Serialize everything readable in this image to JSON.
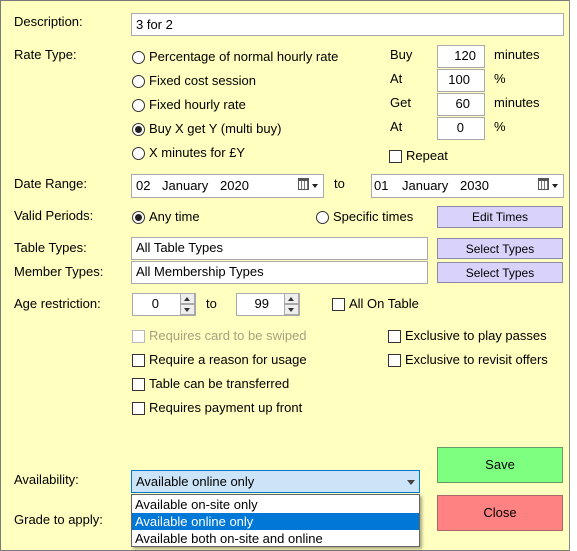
{
  "labels": {
    "description": "Description:",
    "rate_type": "Rate Type:",
    "date_range": "Date Range:",
    "valid_periods": "Valid Periods:",
    "table_types": "Table Types:",
    "member_types": "Member Types:",
    "age_restriction": "Age restriction:",
    "availability": "Availability:",
    "grade_to_apply": "Grade to apply:"
  },
  "description": {
    "value": "3 for 2"
  },
  "rate_type": {
    "options": [
      {
        "label": "Percentage of normal hourly rate",
        "selected": false
      },
      {
        "label": "Fixed cost session",
        "selected": false
      },
      {
        "label": "Fixed hourly rate",
        "selected": false
      },
      {
        "label": "Buy X get Y (multi buy)",
        "selected": true
      },
      {
        "label": "X minutes for £Y",
        "selected": false
      }
    ],
    "params": [
      {
        "label": "Buy",
        "value": "120",
        "unit": "minutes"
      },
      {
        "label": "At",
        "value": "100",
        "unit": "%"
      },
      {
        "label": "Get",
        "value": "60",
        "unit": "minutes"
      },
      {
        "label": "At",
        "value": "0",
        "unit": "%"
      }
    ],
    "repeat_label": "Repeat",
    "repeat_checked": false
  },
  "date_range": {
    "from": {
      "day": "02",
      "month": "January",
      "year": "2020"
    },
    "to_label": "to",
    "to": {
      "day": "01",
      "month": "January",
      "year": "2030"
    }
  },
  "valid_periods": {
    "any_time": "Any time",
    "specific_times": "Specific times",
    "selected": "any_time",
    "edit_button": "Edit Times"
  },
  "table_types": {
    "value": "All Table Types",
    "button": "Select Types"
  },
  "member_types": {
    "value": "All Membership Types",
    "button": "Select Types"
  },
  "age": {
    "min": "0",
    "to_label": "to",
    "max": "99",
    "all_on_table": "All On Table"
  },
  "checks": {
    "requires_card": "Requires card to be swiped",
    "require_reason": "Require a reason for usage",
    "transferable": "Table can be transferred",
    "payment_up_front": "Requires payment up front",
    "exclusive_play_passes": "Exclusive to play passes",
    "exclusive_revisit": "Exclusive to revisit offers"
  },
  "availability": {
    "selected": "Available online only",
    "options": [
      "Available on-site only",
      "Available online only",
      "Available both on-site and online"
    ],
    "highlighted_index": 1
  },
  "buttons": {
    "save": "Save",
    "close": "Close"
  },
  "colors": {
    "background": "#ffffc0",
    "save": "#7fff7f",
    "close": "#ff8282",
    "small_button": "#d9d3fc",
    "selection": "#0078d7"
  }
}
